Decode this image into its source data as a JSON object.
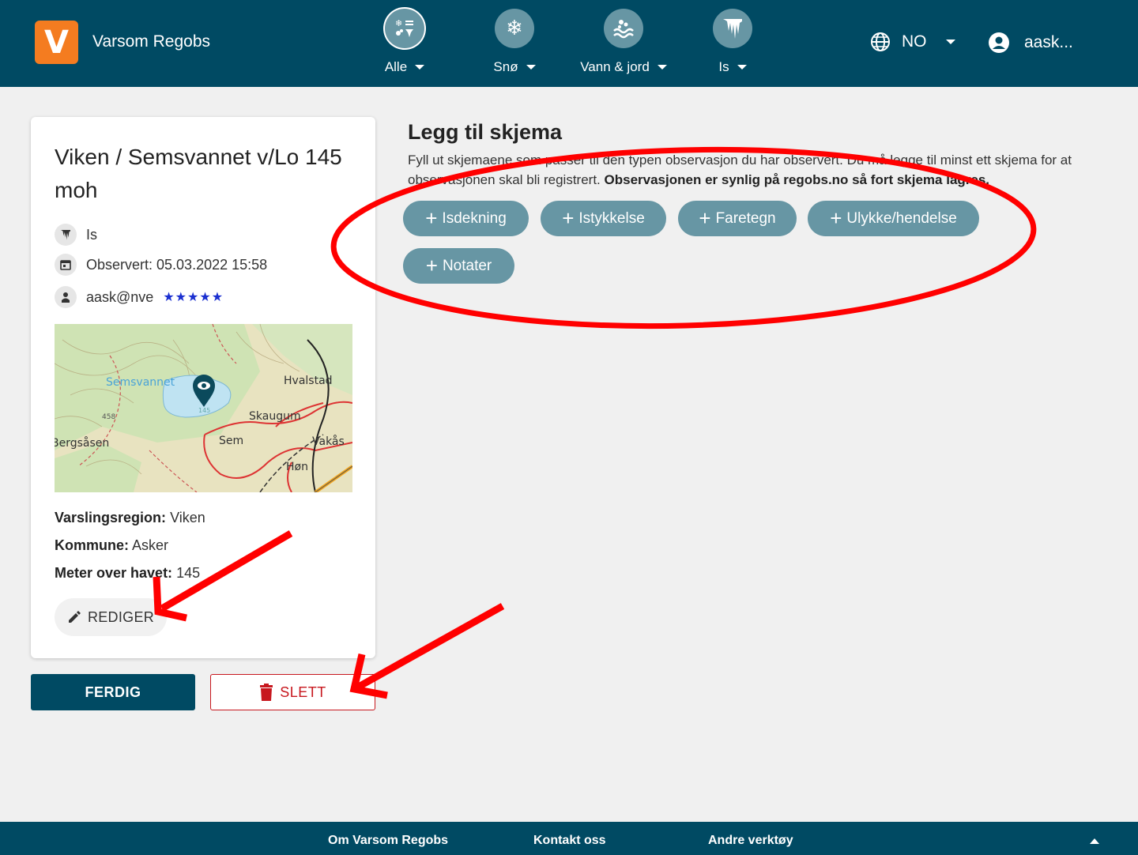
{
  "header": {
    "logo_letter": "V",
    "app_title": "Varsom Regobs",
    "nav": [
      {
        "label": "Alle",
        "icon": "all-observations-icon"
      },
      {
        "label": "Snø",
        "icon": "snowflake-icon"
      },
      {
        "label": "Vann & jord",
        "icon": "water-icon"
      },
      {
        "label": "Is",
        "icon": "ice-icon"
      }
    ],
    "language": "NO",
    "user": "aask..."
  },
  "card": {
    "title": "Viken / Semsvannet v/Lo 145 moh",
    "type": "Is",
    "observed": "Observert: 05.03.2022 15:58",
    "observer": "aask@nve",
    "stars": "★★★★★",
    "map_labels": {
      "semsvannet": "Semsvannet",
      "hvalstad": "Hvalstad",
      "skaugum": "Skaugum",
      "sem": "Sem",
      "vakas": "Vakås",
      "hon": "Høn",
      "bergsasen": "Bergsåsen",
      "elev_458": "458",
      "elev_145": "145"
    },
    "region_label": "Varslingsregion:",
    "region_value": "Viken",
    "municipality_label": "Kommune:",
    "municipality_value": "Asker",
    "altitude_label": "Meter over havet:",
    "altitude_value": "145",
    "edit_label": "REDIGER"
  },
  "actions": {
    "done_label": "FERDIG",
    "delete_label": "SLETT"
  },
  "schema": {
    "title": "Legg til skjema",
    "desc_plain": "Fyll ut skjemaene som passer til den typen observasjon du har observert. Du må legge til minst ett skjema for at observasjonen skal bli registrert. ",
    "desc_bold": "Observasjonen er synlig på regobs.no så fort skjema lagres.",
    "chips": [
      "Isdekning",
      "Istykkelse",
      "Faretegn",
      "Ulykke/hendelse",
      "Notater"
    ]
  },
  "footer": {
    "links": [
      "Om Varsom Regobs",
      "Kontakt oss",
      "Andre verktøy"
    ]
  },
  "colors": {
    "primary": "#004a63",
    "chip": "#6796a4",
    "logo": "#f47c20",
    "danger": "#c7171e",
    "annotation": "#ff0000"
  }
}
